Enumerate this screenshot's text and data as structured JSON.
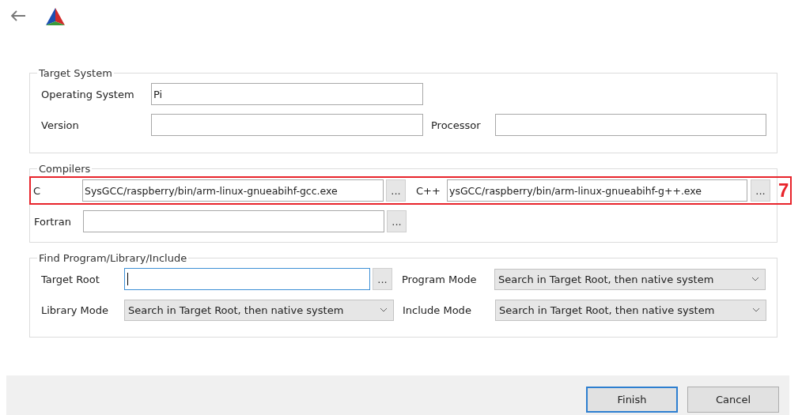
{
  "groups": [
    {
      "title": "Target System",
      "rows": [
        {
          "highlighted": false,
          "items": [
            {
              "kind": "label",
              "text": "Operating System"
            },
            {
              "kind": "field",
              "value": "Pi",
              "focused": false
            }
          ]
        },
        {
          "highlighted": false,
          "items": [
            {
              "kind": "label",
              "text": "Version"
            },
            {
              "kind": "field",
              "focused": false
            },
            {
              "kind": "label",
              "text": "Processor"
            },
            {
              "kind": "field",
              "focused": false
            }
          ]
        }
      ]
    },
    {
      "title": "Compilers",
      "rows": [
        {
          "highlighted": true,
          "items": [
            {
              "kind": "label",
              "text": "C"
            },
            {
              "kind": "field",
              "value": "SysGCC/raspberry/bin/arm-linux-gnueabihf-gcc.exe",
              "focused": false
            },
            {
              "kind": "browse",
              "text": "..."
            },
            {
              "kind": "label",
              "text": "C++"
            },
            {
              "kind": "field",
              "value": "ysGCC/raspberry/bin/arm-linux-gnueabihf-g++.exe",
              "focused": false
            },
            {
              "kind": "browse",
              "text": "..."
            },
            {
              "kind": "annotation",
              "text": "7"
            }
          ]
        },
        {
          "highlighted": false,
          "items": [
            {
              "kind": "label",
              "text": "Fortran"
            },
            {
              "kind": "field",
              "focused": false
            },
            {
              "kind": "browse",
              "text": "..."
            }
          ]
        }
      ]
    },
    {
      "title": "Find Program/Library/Include",
      "rows": [
        {
          "highlighted": false,
          "items": [
            {
              "kind": "label",
              "text": "Target Root"
            },
            {
              "kind": "field",
              "focused": true
            },
            {
              "kind": "browse",
              "text": "..."
            },
            {
              "kind": "label",
              "text": "Program Mode"
            },
            {
              "kind": "combo",
              "value": "Search in Target Root, then native system"
            }
          ]
        },
        {
          "highlighted": false,
          "items": [
            {
              "kind": "label",
              "text": "Library Mode"
            },
            {
              "kind": "combo",
              "value": "Search in Target Root, then native system"
            },
            {
              "kind": "label",
              "text": "Include Mode"
            },
            {
              "kind": "combo",
              "value": "Search in Target Root, then native system"
            }
          ]
        }
      ]
    }
  ],
  "buttons": [
    {
      "label": "Finish",
      "default": true
    },
    {
      "label": "Cancel",
      "default": false
    }
  ]
}
